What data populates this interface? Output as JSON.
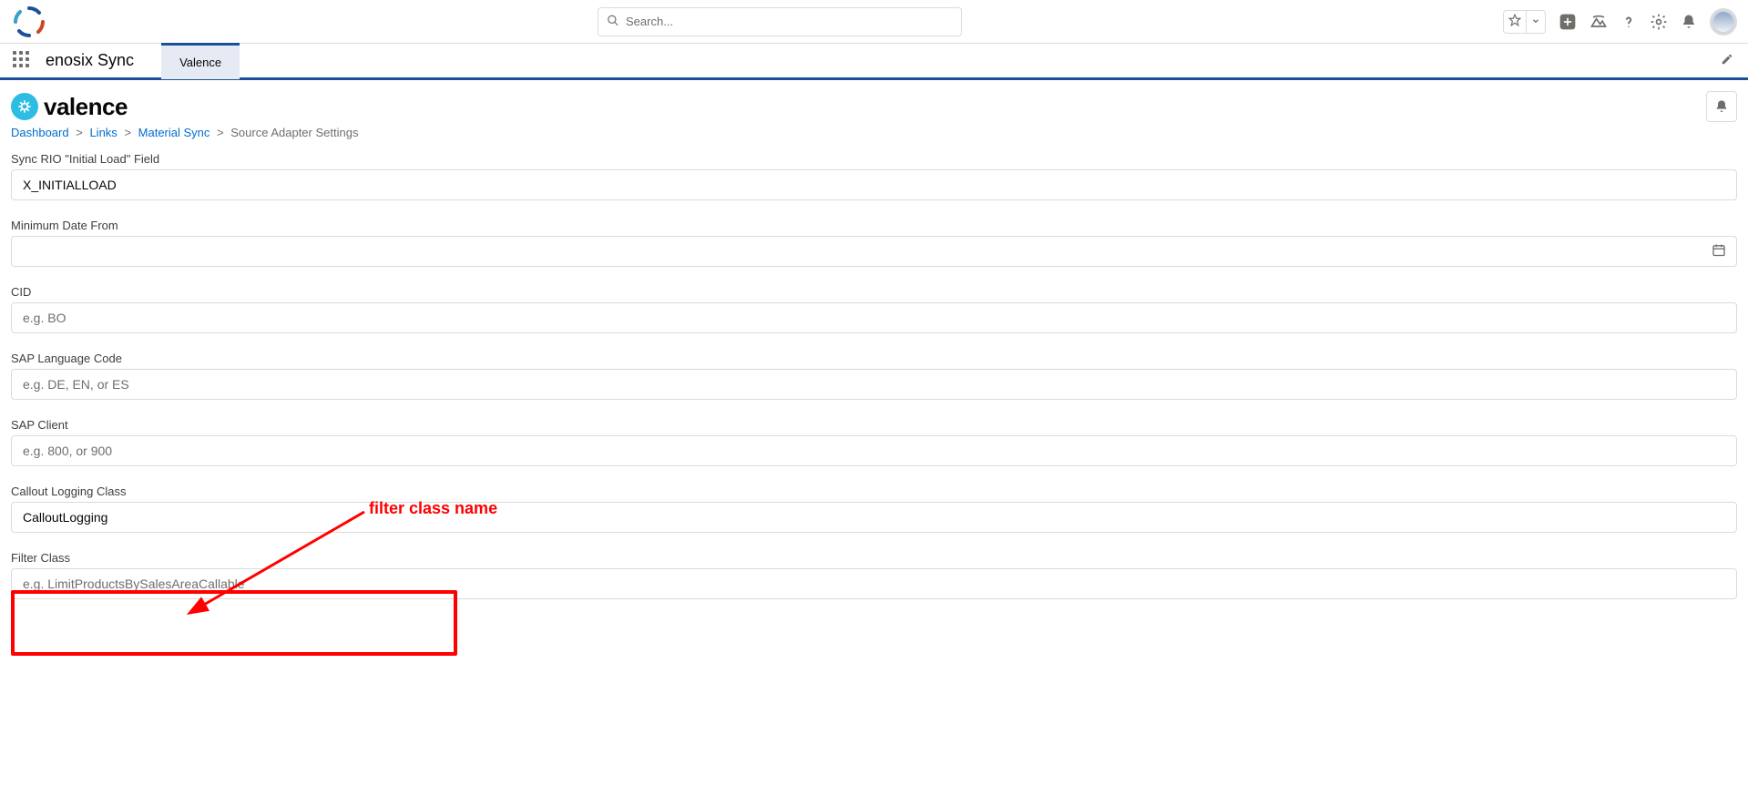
{
  "header": {
    "search_placeholder": "Search...",
    "app_name": "enosix Sync",
    "active_tab": "Valence"
  },
  "page": {
    "app_title": "valence",
    "breadcrumbs": {
      "dashboard": "Dashboard",
      "links": "Links",
      "material_sync": "Material Sync",
      "current": "Source Adapter Settings"
    }
  },
  "fields": {
    "sync_rio": {
      "label": "Sync RIO \"Initial Load\" Field",
      "value": "X_INITIALLOAD"
    },
    "min_date_from": {
      "label": "Minimum Date From",
      "value": ""
    },
    "cid": {
      "label": "CID",
      "placeholder": "e.g. BO",
      "value": ""
    },
    "sap_lang": {
      "label": "SAP Language Code",
      "placeholder": "e.g. DE, EN, or ES",
      "value": ""
    },
    "sap_client": {
      "label": "SAP Client",
      "placeholder": "e.g. 800, or 900",
      "value": ""
    },
    "callout_logging": {
      "label": "Callout Logging Class",
      "value": "CalloutLogging"
    },
    "filter_class": {
      "label": "Filter Class",
      "placeholder": "e.g. LimitProductsBySalesAreaCallable",
      "value": ""
    }
  },
  "annotation": {
    "text": "filter class name"
  }
}
